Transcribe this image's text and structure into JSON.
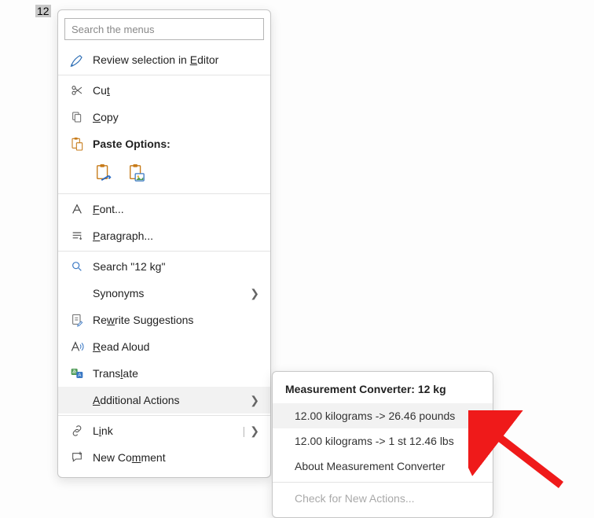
{
  "selection_text": "12",
  "search_placeholder": "Search the menus",
  "menu": {
    "review": "Review selection in Editor",
    "cut": "Cut",
    "copy": "Copy",
    "paste_options": "Paste Options:",
    "font": "Font...",
    "paragraph": "Paragraph...",
    "search_12kg": "Search \"12 kg\"",
    "synonyms": "Synonyms",
    "rewrite": "Rewrite Suggestions",
    "read_aloud": "Read Aloud",
    "translate": "Translate",
    "additional_actions": "Additional Actions",
    "link": "Link",
    "new_comment": "New Comment"
  },
  "submenu": {
    "title": "Measurement Converter: 12 kg",
    "items": [
      "12.00 kilograms -> 26.46 pounds",
      "12.00 kilograms -> 1 st 12.46 lbs",
      "About Measurement Converter",
      "Check for New Actions..."
    ]
  },
  "chevron": "❯",
  "link_chevron_split": "❯"
}
